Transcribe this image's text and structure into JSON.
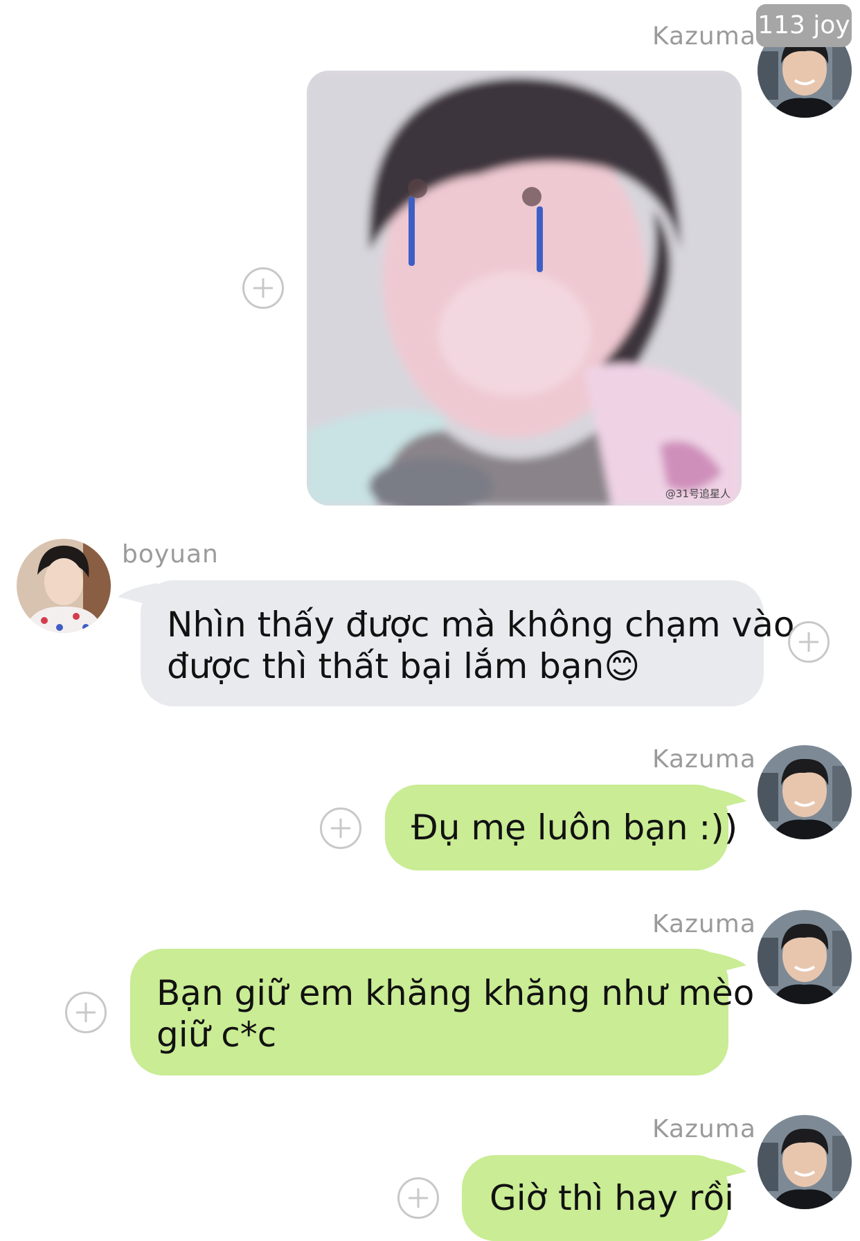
{
  "badge": {
    "text": "113 joy"
  },
  "messages": [
    {
      "sender": "Kazuma",
      "type": "image"
    },
    {
      "sender": "boyuan",
      "line1": "Nhìn thấy được mà không chạm vào",
      "line2": "được thì thất bại lắm bạn",
      "emoji": "😊"
    },
    {
      "sender": "Kazuma",
      "text": "Đụ mẹ luôn bạn :))"
    },
    {
      "sender": "Kazuma",
      "line1": "Bạn giữ em khăng khăng như mèo",
      "line2": "giữ c*c"
    },
    {
      "sender": "Kazuma",
      "text": "Giờ thì hay rồi"
    }
  ],
  "sticker": {
    "watermark": "@31号追星人"
  },
  "colors": {
    "outgoing": "#c9ec94",
    "incoming": "#e8eaed",
    "name": "#9a9a9a"
  }
}
